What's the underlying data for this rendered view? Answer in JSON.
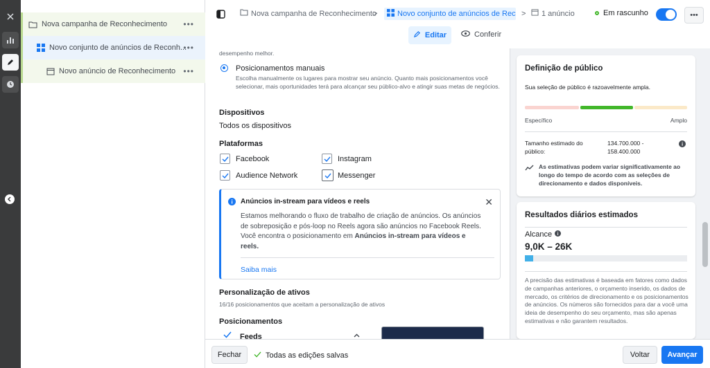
{
  "tree": {
    "campaign": "Nova campanha de Reconhecimento",
    "adset": "Novo conjunto de anúncios de Reconh...",
    "ad": "Novo anúncio de Reconhecimento",
    "dots": "•••"
  },
  "breadcrumb": {
    "campaign": "Nova campanha de Reconhecimento",
    "adset": "Novo conjunto de anúncios de Reconl",
    "ad": "1 anúncio",
    "sep": ">"
  },
  "status": "Em rascunho",
  "more": "•••",
  "tabs": {
    "edit": "Editar",
    "review": "Conferir"
  },
  "placements": {
    "top_text": "desempenho melhor.",
    "manual_title": "Posicionamentos manuais",
    "manual_desc": "Escolha manualmente os lugares para mostrar seu anúncio. Quanto mais posicionamentos você selecionar, mais oportunidades terá para alcançar seu público-alvo e atingir suas metas de negócios.",
    "devices_title": "Dispositivos",
    "devices_value": "Todos os dispositivos",
    "platforms_title": "Plataformas",
    "platforms": [
      "Facebook",
      "Instagram",
      "Audience Network",
      "Messenger"
    ]
  },
  "info": {
    "title": "Anúncios in-stream para vídeos e reels",
    "body_prefix": "Estamos melhorando o fluxo de trabalho de criação de anúncios. Os anúncios de sobreposição e pós-loop no Reels agora são anúncios no Facebook Reels. Você encontra o posicionamento em ",
    "body_bold": "Anúncios in-stream para vídeos e reels.",
    "link": "Saiba mais",
    "close": "✕"
  },
  "asset": {
    "title": "Personalização de ativos",
    "desc": "16/16 posicionamentos que aceitam a personalização de ativos"
  },
  "positions": {
    "title": "Posicionamentos",
    "feeds": "Feeds"
  },
  "audience": {
    "title": "Definição de público",
    "desc": "Sua seleção de público é razoavelmente ampla.",
    "specific": "Específico",
    "broad": "Amplo",
    "size_label": "Tamanho estimado do público:",
    "size_value": "134.700.000 - 158.400.000",
    "note": "As estimativas podem variar significativamente ao longo do tempo de acordo com as seleções de direcionamento e dados disponíveis."
  },
  "daily": {
    "title": "Resultados diários estimados",
    "reach_label": "Alcance",
    "reach_value": "9,0K – 26K",
    "reach_fill": 0.05,
    "disclaimer": "A precisão das estimativas é baseada em fatores como dados de campanhas anteriores, o orçamento inserido, os dados de mercado, os critérios de direcionamento e os posicionamentos de anúncios. Os números são fornecidos para dar a você uma ideia de desempenho do seu orçamento, mas são apenas estimativas e não garantem resultados."
  },
  "footer": {
    "close": "Fechar",
    "saved": "Todas as edições salvas",
    "back": "Voltar",
    "next": "Avançar"
  },
  "colors": {
    "accent": "#1877f2",
    "meter_active": "#42b72a",
    "meter_low": "#fad4d0",
    "meter_high": "#fbe9c8"
  }
}
